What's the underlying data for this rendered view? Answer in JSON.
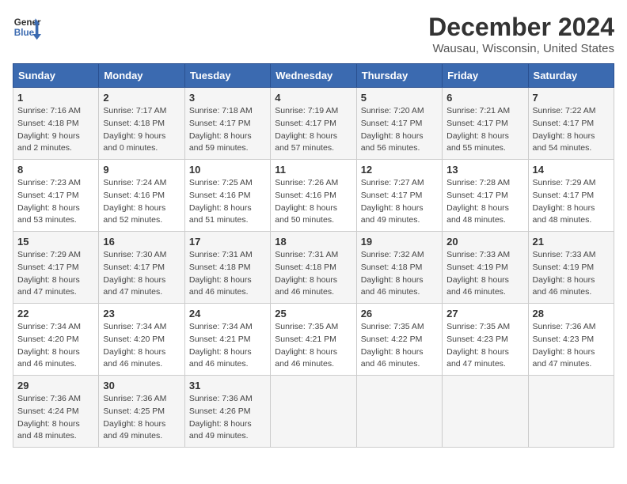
{
  "header": {
    "logo_line1": "General",
    "logo_line2": "Blue",
    "title": "December 2024",
    "subtitle": "Wausau, Wisconsin, United States"
  },
  "days_of_week": [
    "Sunday",
    "Monday",
    "Tuesday",
    "Wednesday",
    "Thursday",
    "Friday",
    "Saturday"
  ],
  "weeks": [
    [
      {
        "day": "1",
        "sunrise": "7:16 AM",
        "sunset": "4:18 PM",
        "daylight": "9 hours and 2 minutes."
      },
      {
        "day": "2",
        "sunrise": "7:17 AM",
        "sunset": "4:18 PM",
        "daylight": "9 hours and 0 minutes."
      },
      {
        "day": "3",
        "sunrise": "7:18 AM",
        "sunset": "4:17 PM",
        "daylight": "8 hours and 59 minutes."
      },
      {
        "day": "4",
        "sunrise": "7:19 AM",
        "sunset": "4:17 PM",
        "daylight": "8 hours and 57 minutes."
      },
      {
        "day": "5",
        "sunrise": "7:20 AM",
        "sunset": "4:17 PM",
        "daylight": "8 hours and 56 minutes."
      },
      {
        "day": "6",
        "sunrise": "7:21 AM",
        "sunset": "4:17 PM",
        "daylight": "8 hours and 55 minutes."
      },
      {
        "day": "7",
        "sunrise": "7:22 AM",
        "sunset": "4:17 PM",
        "daylight": "8 hours and 54 minutes."
      }
    ],
    [
      {
        "day": "8",
        "sunrise": "7:23 AM",
        "sunset": "4:17 PM",
        "daylight": "8 hours and 53 minutes."
      },
      {
        "day": "9",
        "sunrise": "7:24 AM",
        "sunset": "4:16 PM",
        "daylight": "8 hours and 52 minutes."
      },
      {
        "day": "10",
        "sunrise": "7:25 AM",
        "sunset": "4:16 PM",
        "daylight": "8 hours and 51 minutes."
      },
      {
        "day": "11",
        "sunrise": "7:26 AM",
        "sunset": "4:16 PM",
        "daylight": "8 hours and 50 minutes."
      },
      {
        "day": "12",
        "sunrise": "7:27 AM",
        "sunset": "4:17 PM",
        "daylight": "8 hours and 49 minutes."
      },
      {
        "day": "13",
        "sunrise": "7:28 AM",
        "sunset": "4:17 PM",
        "daylight": "8 hours and 48 minutes."
      },
      {
        "day": "14",
        "sunrise": "7:29 AM",
        "sunset": "4:17 PM",
        "daylight": "8 hours and 48 minutes."
      }
    ],
    [
      {
        "day": "15",
        "sunrise": "7:29 AM",
        "sunset": "4:17 PM",
        "daylight": "8 hours and 47 minutes."
      },
      {
        "day": "16",
        "sunrise": "7:30 AM",
        "sunset": "4:17 PM",
        "daylight": "8 hours and 47 minutes."
      },
      {
        "day": "17",
        "sunrise": "7:31 AM",
        "sunset": "4:18 PM",
        "daylight": "8 hours and 46 minutes."
      },
      {
        "day": "18",
        "sunrise": "7:31 AM",
        "sunset": "4:18 PM",
        "daylight": "8 hours and 46 minutes."
      },
      {
        "day": "19",
        "sunrise": "7:32 AM",
        "sunset": "4:18 PM",
        "daylight": "8 hours and 46 minutes."
      },
      {
        "day": "20",
        "sunrise": "7:33 AM",
        "sunset": "4:19 PM",
        "daylight": "8 hours and 46 minutes."
      },
      {
        "day": "21",
        "sunrise": "7:33 AM",
        "sunset": "4:19 PM",
        "daylight": "8 hours and 46 minutes."
      }
    ],
    [
      {
        "day": "22",
        "sunrise": "7:34 AM",
        "sunset": "4:20 PM",
        "daylight": "8 hours and 46 minutes."
      },
      {
        "day": "23",
        "sunrise": "7:34 AM",
        "sunset": "4:20 PM",
        "daylight": "8 hours and 46 minutes."
      },
      {
        "day": "24",
        "sunrise": "7:34 AM",
        "sunset": "4:21 PM",
        "daylight": "8 hours and 46 minutes."
      },
      {
        "day": "25",
        "sunrise": "7:35 AM",
        "sunset": "4:21 PM",
        "daylight": "8 hours and 46 minutes."
      },
      {
        "day": "26",
        "sunrise": "7:35 AM",
        "sunset": "4:22 PM",
        "daylight": "8 hours and 46 minutes."
      },
      {
        "day": "27",
        "sunrise": "7:35 AM",
        "sunset": "4:23 PM",
        "daylight": "8 hours and 47 minutes."
      },
      {
        "day": "28",
        "sunrise": "7:36 AM",
        "sunset": "4:23 PM",
        "daylight": "8 hours and 47 minutes."
      }
    ],
    [
      {
        "day": "29",
        "sunrise": "7:36 AM",
        "sunset": "4:24 PM",
        "daylight": "8 hours and 48 minutes."
      },
      {
        "day": "30",
        "sunrise": "7:36 AM",
        "sunset": "4:25 PM",
        "daylight": "8 hours and 49 minutes."
      },
      {
        "day": "31",
        "sunrise": "7:36 AM",
        "sunset": "4:26 PM",
        "daylight": "8 hours and 49 minutes."
      },
      null,
      null,
      null,
      null
    ]
  ]
}
